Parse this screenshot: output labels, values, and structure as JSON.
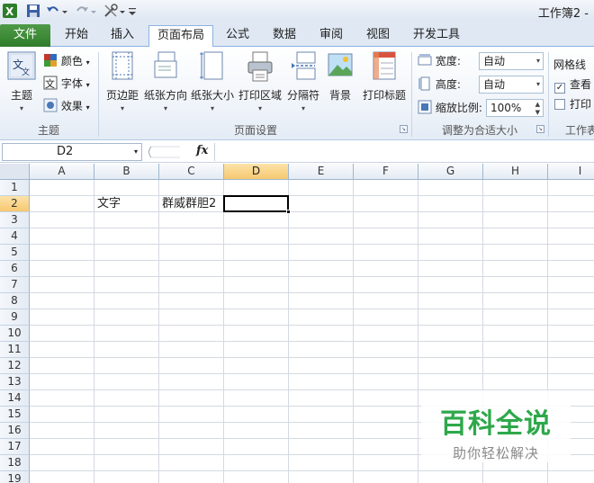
{
  "title": "工作簿2 -",
  "tabs": [
    "文件",
    "开始",
    "插入",
    "页面布局",
    "公式",
    "数据",
    "审阅",
    "视图",
    "开发工具"
  ],
  "active_tab": "页面布局",
  "ribbon": {
    "themes": {
      "main": "主题",
      "colors": "颜色",
      "fonts": "字体",
      "effects": "效果",
      "group": "主题"
    },
    "page_setup": {
      "margins": "页边距",
      "orientation": "纸张方向",
      "size": "纸张大小",
      "print_area": "打印区域",
      "breaks": "分隔符",
      "background": "背景",
      "print_titles": "打印标题",
      "group": "页面设置"
    },
    "scale": {
      "width_label": "宽度:",
      "width_value": "自动",
      "height_label": "高度:",
      "height_value": "自动",
      "scale_label": "缩放比例:",
      "scale_value": "100%",
      "group": "调整为合适大小"
    },
    "sheet_options": {
      "gridlines": "网格线",
      "view": "查看",
      "print": "打印",
      "group": "工作表"
    }
  },
  "formula_bar": {
    "name_box": "D2",
    "fx": "fx",
    "value": ""
  },
  "columns": [
    "A",
    "B",
    "C",
    "D",
    "E",
    "F",
    "G",
    "H",
    "I"
  ],
  "rows": [
    "1",
    "2",
    "3",
    "4",
    "5",
    "6",
    "7",
    "8",
    "9",
    "10",
    "11",
    "12",
    "13",
    "14",
    "15",
    "16",
    "17",
    "18",
    "19"
  ],
  "cells": {
    "B2": "文字",
    "C2": "群威群胆2"
  },
  "selected_cell": "D2",
  "watermark": {
    "title": "百科全说",
    "subtitle": "助你轻松解决"
  },
  "colors": {
    "accent": "#2f7d2a",
    "selection": "#f6c870",
    "ribbon_border": "#8db2e3",
    "watermark": "#2ea84a"
  }
}
